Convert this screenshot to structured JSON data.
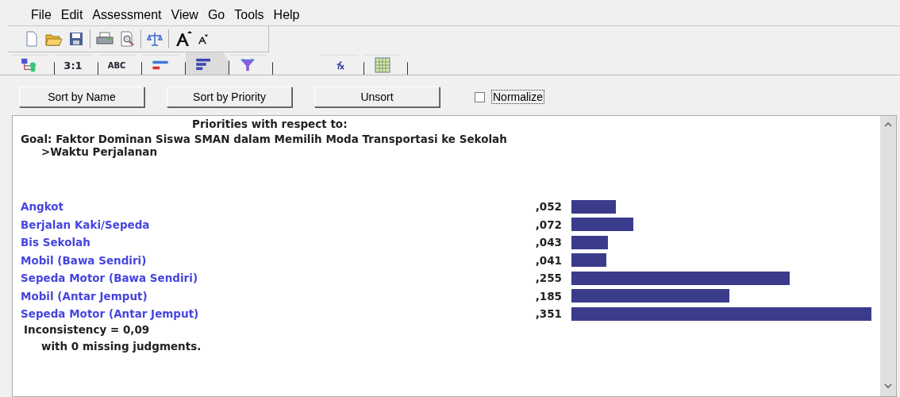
{
  "menu": [
    "File",
    "Edit",
    "Assessment",
    "View",
    "Go",
    "Tools",
    "Help"
  ],
  "toolbar": [
    {
      "kind": "new"
    },
    {
      "kind": "open"
    },
    {
      "kind": "save"
    },
    {
      "kind": "sep"
    },
    {
      "kind": "print"
    },
    {
      "kind": "preview"
    },
    {
      "kind": "sep"
    },
    {
      "kind": "scale"
    },
    {
      "kind": "sep"
    },
    {
      "kind": "font-up"
    },
    {
      "kind": "font-down"
    }
  ],
  "tabs": [
    {
      "kind": "tree",
      "selected": false
    },
    {
      "kind": "pairwise",
      "label": "3:1",
      "selected": false
    },
    {
      "kind": "verbal",
      "label": "ABC",
      "selected": false
    },
    {
      "kind": "graph",
      "selected": false
    },
    {
      "kind": "bars",
      "selected": true
    },
    {
      "kind": "funnel",
      "selected": false
    },
    {
      "kind": "formula",
      "selected": false
    },
    {
      "kind": "grid",
      "selected": false
    }
  ],
  "buttons": [
    "Sort by Name",
    "Sort by Priority",
    "Unsort"
  ],
  "normalize": {
    "label": "Normalize",
    "checked": false
  },
  "report": {
    "heading": "Priorities with respect to:",
    "goal": "Goal: Faktor Dominan Siswa SMAN dalam Memilih Moda Transportasi ke Sekolah",
    "node": ">Waktu Perjalanan",
    "items": [
      {
        "name": "Angkot",
        "priority": ",052"
      },
      {
        "name": "Berjalan Kaki/Sepeda",
        "priority": ",072"
      },
      {
        "name": "Bis Sekolah",
        "priority": ",043"
      },
      {
        "name": "Mobil (Bawa Sendiri)",
        "priority": ",041"
      },
      {
        "name": "Sepeda Motor (Bawa Sendiri)",
        "priority": ",255"
      },
      {
        "name": "Mobil (Antar Jemput)",
        "priority": ",185"
      },
      {
        "name": "Sepeda Motor (Antar Jemput)",
        "priority": ",351"
      }
    ],
    "inconsistency": "Inconsistency = 0,09",
    "missing": "with 0  missing judgments."
  }
}
